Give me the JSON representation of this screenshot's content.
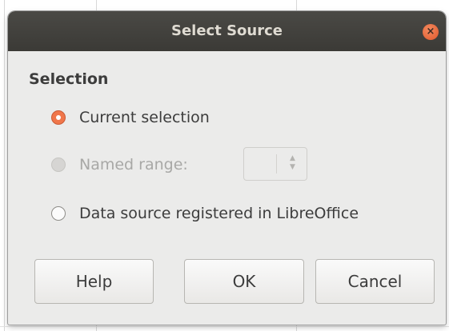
{
  "dialog": {
    "title": "Select Source",
    "close_icon": "close-icon",
    "close_glyph": "×"
  },
  "selection": {
    "section_label": "Selection",
    "options": [
      {
        "label": "Current selection",
        "checked": true,
        "enabled": true
      },
      {
        "label": "Named range:",
        "checked": false,
        "enabled": false
      },
      {
        "label": "Data source registered in LibreOffice",
        "checked": false,
        "enabled": true
      }
    ],
    "named_range_value": "",
    "spin_up_glyph": "▲",
    "spin_down_glyph": "▼"
  },
  "buttons": {
    "help": "Help",
    "ok": "OK",
    "cancel": "Cancel"
  },
  "colors": {
    "accent": "#f0764a",
    "titlebar": "#3e3d39",
    "dialog_bg": "#ebebea"
  }
}
